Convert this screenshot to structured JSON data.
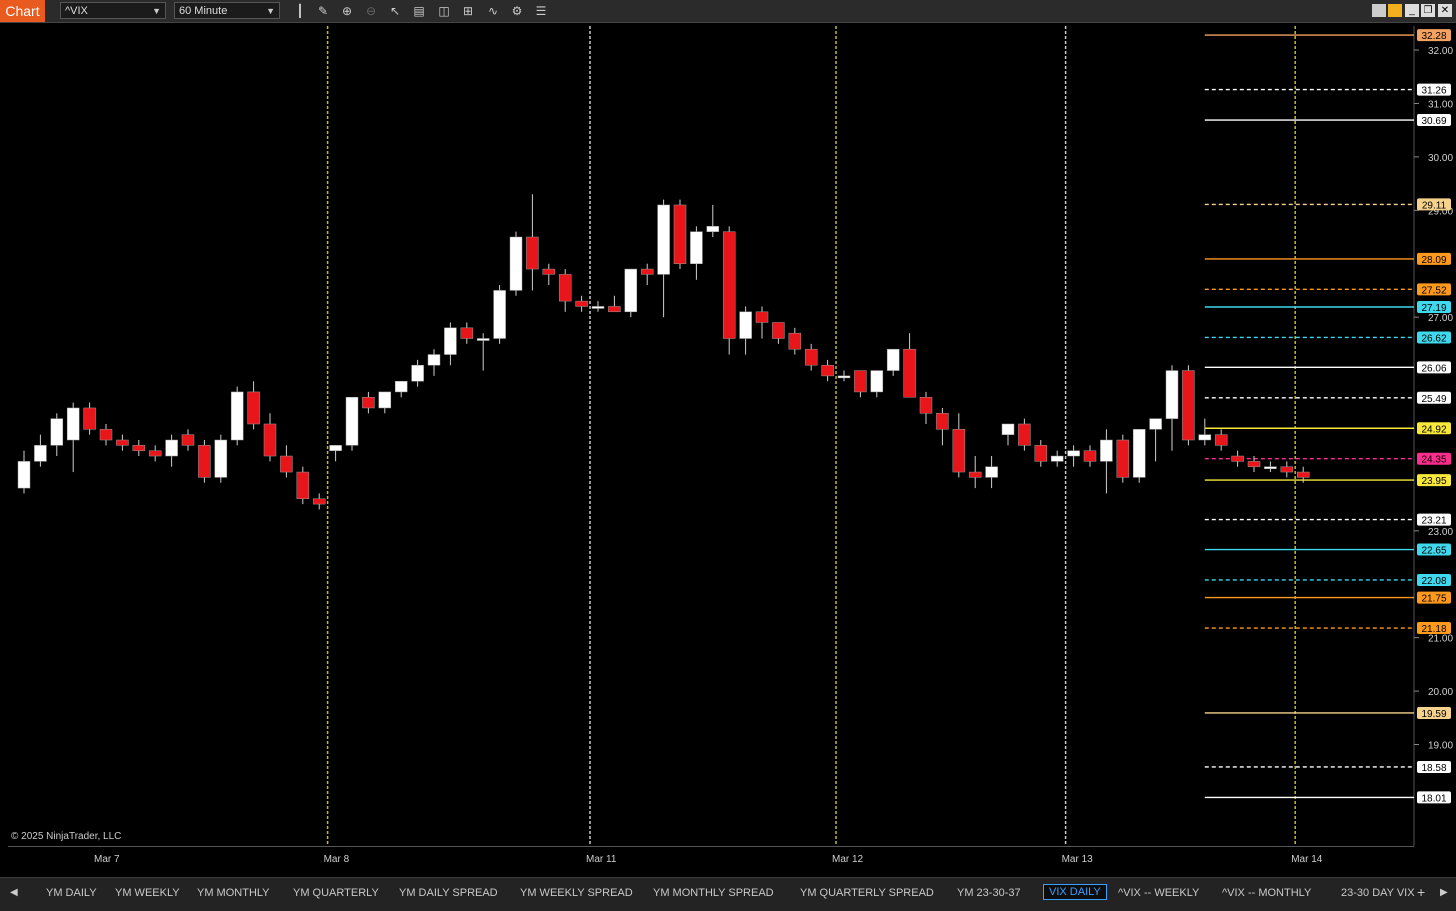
{
  "toolbar": {
    "chart_tab": "Chart",
    "instrument": "^VIX",
    "interval": "60 Minute",
    "icons": [
      "bar-type-icon",
      "draw-pencil-icon",
      "zoom-in-icon",
      "zoom-out-icon",
      "pointer-icon",
      "data-box-icon",
      "split-panel-icon",
      "chart-trader-icon",
      "indicators-icon",
      "properties-icon",
      "strategies-icon"
    ],
    "window_icons": [
      "tile-icon",
      "color-icon",
      "minimize-icon",
      "restore-icon",
      "close-icon"
    ]
  },
  "copyright": "© 2025 NinjaTrader, LLC",
  "tabs": [
    "YM DAILY",
    "YM WEEKLY",
    "YM MONTHLY",
    "YM QUARTERLY",
    "YM DAILY SPREAD",
    "YM WEEKLY SPREAD",
    "YM MONTHLY SPREAD",
    "YM QUARTERLY SPREAD",
    "YM 23-30-37",
    "VIX DAILY",
    "^VIX -- WEEKLY",
    "^VIX -- MONTHLY",
    "23-30 DAY VIX"
  ],
  "active_tab": "VIX DAILY",
  "add_tab": "+",
  "chart_data": {
    "type": "candlestick",
    "instrument": "^VIX",
    "interval": "60 Minute",
    "ylim": [
      17.1,
      32.45
    ],
    "axis_ticks": [
      "32.00",
      "31.00",
      "30.00",
      "29.00",
      "27.00",
      "23.00",
      "21.00",
      "20.00",
      "19.00"
    ],
    "x_labels": [
      {
        "label": "Mar 7",
        "bar": 5
      },
      {
        "label": "Mar 8",
        "bar": 19
      },
      {
        "label": "Mar 11",
        "bar": 35
      },
      {
        "label": "Mar 12",
        "bar": 50
      },
      {
        "label": "Mar 13",
        "bar": 64
      },
      {
        "label": "Mar 14",
        "bar": 78
      }
    ],
    "candles": [
      [
        23.8,
        24.5,
        23.7,
        24.3
      ],
      [
        24.3,
        24.8,
        24.2,
        24.6
      ],
      [
        24.6,
        25.2,
        24.4,
        25.1
      ],
      [
        24.7,
        25.4,
        24.1,
        25.3
      ],
      [
        25.3,
        25.4,
        24.8,
        24.9
      ],
      [
        24.9,
        25.0,
        24.6,
        24.7
      ],
      [
        24.7,
        24.8,
        24.5,
        24.6
      ],
      [
        24.6,
        24.7,
        24.4,
        24.5
      ],
      [
        24.5,
        24.6,
        24.3,
        24.4
      ],
      [
        24.4,
        24.8,
        24.2,
        24.7
      ],
      [
        24.8,
        24.9,
        24.5,
        24.6
      ],
      [
        24.6,
        24.7,
        23.9,
        24.0
      ],
      [
        24.0,
        24.8,
        23.9,
        24.7
      ],
      [
        24.7,
        25.7,
        24.6,
        25.6
      ],
      [
        25.6,
        25.8,
        24.9,
        25.0
      ],
      [
        25.0,
        25.2,
        24.3,
        24.4
      ],
      [
        24.4,
        24.6,
        24.0,
        24.1
      ],
      [
        24.1,
        24.2,
        23.5,
        23.6
      ],
      [
        23.6,
        23.7,
        23.4,
        23.5
      ],
      [
        24.5,
        24.6,
        24.3,
        24.6
      ],
      [
        24.6,
        25.5,
        24.5,
        25.5
      ],
      [
        25.5,
        25.6,
        25.2,
        25.3
      ],
      [
        25.3,
        25.6,
        25.2,
        25.6
      ],
      [
        25.6,
        25.8,
        25.5,
        25.8
      ],
      [
        25.8,
        26.2,
        25.7,
        26.1
      ],
      [
        26.1,
        26.4,
        25.9,
        26.3
      ],
      [
        26.3,
        26.9,
        26.1,
        26.8
      ],
      [
        26.8,
        26.9,
        26.5,
        26.6
      ],
      [
        26.6,
        26.7,
        26.0,
        26.6
      ],
      [
        26.6,
        27.6,
        26.5,
        27.5
      ],
      [
        27.5,
        28.6,
        27.4,
        28.5
      ],
      [
        28.5,
        29.3,
        27.5,
        27.9
      ],
      [
        27.9,
        28.0,
        27.6,
        27.8
      ],
      [
        27.8,
        27.9,
        27.1,
        27.3
      ],
      [
        27.3,
        27.4,
        27.1,
        27.2
      ],
      [
        27.2,
        27.3,
        27.1,
        27.2
      ],
      [
        27.2,
        27.4,
        27.1,
        27.1
      ],
      [
        27.1,
        27.9,
        27.0,
        27.9
      ],
      [
        27.9,
        28.0,
        27.6,
        27.8
      ],
      [
        27.8,
        29.2,
        27.0,
        29.1
      ],
      [
        29.1,
        29.2,
        27.9,
        28.0
      ],
      [
        28.0,
        28.7,
        27.7,
        28.6
      ],
      [
        28.6,
        29.1,
        28.5,
        28.7
      ],
      [
        28.6,
        28.7,
        26.3,
        26.6
      ],
      [
        26.6,
        27.2,
        26.3,
        27.1
      ],
      [
        27.1,
        27.2,
        26.6,
        26.9
      ],
      [
        26.9,
        26.8,
        26.5,
        26.6
      ],
      [
        26.7,
        26.8,
        26.3,
        26.4
      ],
      [
        26.4,
        26.5,
        26.0,
        26.1
      ],
      [
        26.1,
        26.2,
        25.8,
        25.9
      ],
      [
        25.9,
        26.0,
        25.8,
        25.9
      ],
      [
        26.0,
        26.0,
        25.5,
        25.6
      ],
      [
        25.6,
        26.0,
        25.5,
        26.0
      ],
      [
        26.0,
        26.4,
        25.9,
        26.4
      ],
      [
        26.4,
        26.7,
        25.6,
        25.5
      ],
      [
        25.5,
        25.6,
        25.0,
        25.2
      ],
      [
        25.2,
        25.3,
        24.6,
        24.9
      ],
      [
        24.9,
        25.2,
        24.0,
        24.1
      ],
      [
        24.1,
        24.4,
        23.8,
        24.0
      ],
      [
        24.0,
        24.4,
        23.8,
        24.2
      ],
      [
        24.8,
        24.9,
        24.6,
        25.0
      ],
      [
        25.0,
        25.1,
        24.5,
        24.6
      ],
      [
        24.6,
        24.7,
        24.2,
        24.3
      ],
      [
        24.3,
        24.5,
        24.2,
        24.4
      ],
      [
        24.4,
        24.6,
        24.2,
        24.5
      ],
      [
        24.5,
        24.6,
        24.2,
        24.3
      ],
      [
        24.3,
        24.9,
        23.7,
        24.7
      ],
      [
        24.7,
        24.8,
        23.9,
        24.0
      ],
      [
        24.0,
        24.9,
        23.9,
        24.9
      ],
      [
        24.9,
        25.1,
        24.3,
        25.1
      ],
      [
        25.1,
        26.1,
        24.5,
        26.0
      ],
      [
        26.0,
        26.1,
        24.6,
        24.7
      ],
      [
        24.7,
        25.1,
        24.6,
        24.8
      ],
      [
        24.8,
        24.9,
        24.5,
        24.6
      ],
      [
        24.4,
        24.5,
        24.2,
        24.3
      ],
      [
        24.3,
        24.4,
        24.1,
        24.2
      ],
      [
        24.2,
        24.3,
        24.1,
        24.2
      ],
      [
        24.2,
        24.3,
        24.0,
        24.1
      ],
      [
        24.1,
        24.2,
        23.9,
        24.0
      ]
    ],
    "levels": [
      {
        "value": "32.28",
        "color": "#f4a261"
      },
      {
        "value": "31.26",
        "color": "#ffffff"
      },
      {
        "value": "30.69",
        "color": "#ffffff"
      },
      {
        "value": "29.11",
        "color": "#f6d38c"
      },
      {
        "value": "28.09",
        "color": "#ff9a1f"
      },
      {
        "value": "27.52",
        "color": "#ff9a1f"
      },
      {
        "value": "27.19",
        "color": "#3fd8ec"
      },
      {
        "value": "26.62",
        "color": "#3fd8ec"
      },
      {
        "value": "26.06",
        "color": "#ffffff"
      },
      {
        "value": "25.49",
        "color": "#ffffff"
      },
      {
        "value": "24.92",
        "color": "#f7e83a"
      },
      {
        "value": "24.35",
        "color": "#ff2d8d"
      },
      {
        "value": "23.95",
        "color": "#f7e83a"
      },
      {
        "value": "23.21",
        "color": "#ffffff"
      },
      {
        "value": "22.65",
        "color": "#3fd8ec"
      },
      {
        "value": "22.08",
        "color": "#3fd8ec"
      },
      {
        "value": "21.75",
        "color": "#ff9a1f"
      },
      {
        "value": "21.18",
        "color": "#ff9a1f"
      },
      {
        "value": "19.59",
        "color": "#f6d38c"
      },
      {
        "value": "18.58",
        "color": "#ffffff"
      },
      {
        "value": "18.01",
        "color": "#ffffff"
      }
    ],
    "colors": {
      "up": "#ffffff",
      "down": "#e8161a",
      "background": "#000000"
    }
  }
}
